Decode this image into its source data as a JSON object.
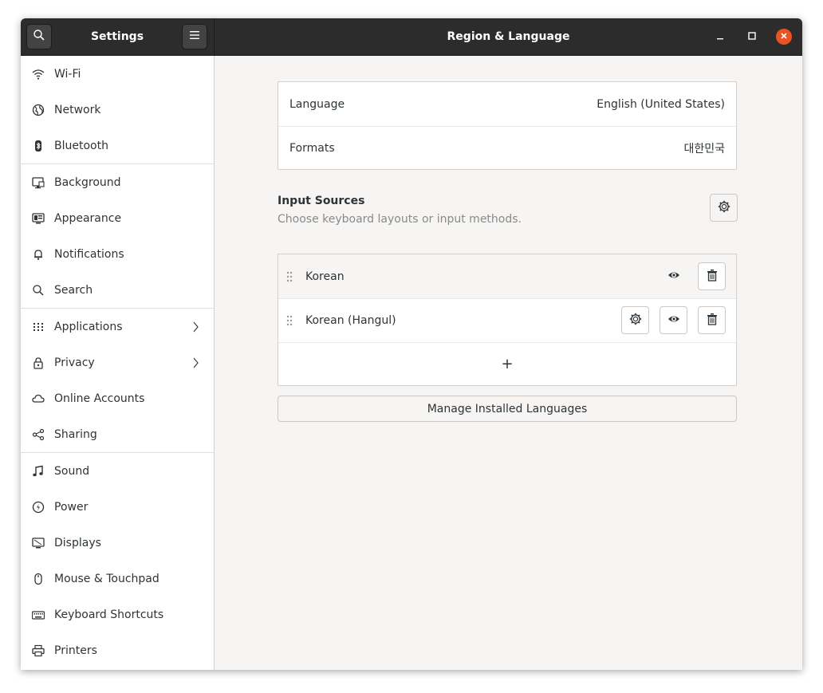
{
  "titlebar": {
    "app_title": "Settings",
    "panel_title": "Region & Language"
  },
  "sidebar": {
    "items": [
      {
        "label": "Wi-Fi",
        "icon": "wifi-icon"
      },
      {
        "label": "Network",
        "icon": "network-icon"
      },
      {
        "label": "Bluetooth",
        "icon": "bluetooth-icon"
      },
      {
        "label": "Background",
        "icon": "background-icon"
      },
      {
        "label": "Appearance",
        "icon": "appearance-icon"
      },
      {
        "label": "Notifications",
        "icon": "bell-icon"
      },
      {
        "label": "Search",
        "icon": "search-icon"
      },
      {
        "label": "Applications",
        "icon": "grid-icon"
      },
      {
        "label": "Privacy",
        "icon": "lock-icon"
      },
      {
        "label": "Online Accounts",
        "icon": "cloud-icon"
      },
      {
        "label": "Sharing",
        "icon": "share-icon"
      },
      {
        "label": "Sound",
        "icon": "music-note-icon"
      },
      {
        "label": "Power",
        "icon": "power-icon"
      },
      {
        "label": "Displays",
        "icon": "display-icon"
      },
      {
        "label": "Mouse & Touchpad",
        "icon": "mouse-icon"
      },
      {
        "label": "Keyboard Shortcuts",
        "icon": "keyboard-icon"
      },
      {
        "label": "Printers",
        "icon": "printer-icon"
      }
    ]
  },
  "region": {
    "language_label": "Language",
    "language_value": "English (United States)",
    "formats_label": "Formats",
    "formats_value": "대한민국"
  },
  "input_sources": {
    "title": "Input Sources",
    "subtitle": "Choose keyboard layouts or input methods.",
    "items": [
      {
        "label": "Korean"
      },
      {
        "label": "Korean (Hangul)"
      }
    ],
    "add_symbol": "+"
  },
  "manage_button": "Manage Installed Languages",
  "colors": {
    "headerbar": "#2c2c2c",
    "accent_close": "#e95420",
    "content_bg": "#f6f5f4"
  }
}
